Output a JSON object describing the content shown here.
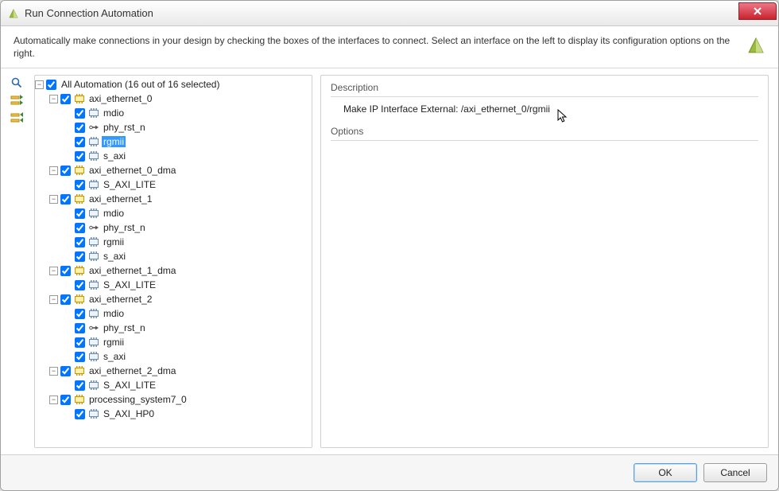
{
  "title": "Run Connection Automation",
  "intro": "Automatically make connections in your design by checking the boxes of the interfaces to connect. Select an interface on the left to display its configuration options on the right.",
  "section": {
    "description_label": "Description",
    "options_label": "Options"
  },
  "description_value": "Make IP Interface External: /axi_ethernet_0/rgmii",
  "buttons": {
    "ok": "OK",
    "cancel": "Cancel"
  },
  "tree": {
    "root": {
      "label": "All Automation (16 out of 16 selected)",
      "checked": true,
      "expanded": true
    },
    "nodes": [
      {
        "label": "axi_ethernet_0",
        "type": "ip",
        "checked": true,
        "expanded": true,
        "children": [
          {
            "label": "mdio",
            "type": "intf",
            "checked": true
          },
          {
            "label": "phy_rst_n",
            "type": "port",
            "checked": true
          },
          {
            "label": "rgmii",
            "type": "intf",
            "checked": true,
            "selected": true
          },
          {
            "label": "s_axi",
            "type": "intf",
            "checked": true
          }
        ]
      },
      {
        "label": "axi_ethernet_0_dma",
        "type": "ip",
        "checked": true,
        "expanded": true,
        "children": [
          {
            "label": "S_AXI_LITE",
            "type": "intf",
            "checked": true
          }
        ]
      },
      {
        "label": "axi_ethernet_1",
        "type": "ip",
        "checked": true,
        "expanded": true,
        "children": [
          {
            "label": "mdio",
            "type": "intf",
            "checked": true
          },
          {
            "label": "phy_rst_n",
            "type": "port",
            "checked": true
          },
          {
            "label": "rgmii",
            "type": "intf",
            "checked": true
          },
          {
            "label": "s_axi",
            "type": "intf",
            "checked": true
          }
        ]
      },
      {
        "label": "axi_ethernet_1_dma",
        "type": "ip",
        "checked": true,
        "expanded": true,
        "children": [
          {
            "label": "S_AXI_LITE",
            "type": "intf",
            "checked": true
          }
        ]
      },
      {
        "label": "axi_ethernet_2",
        "type": "ip",
        "checked": true,
        "expanded": true,
        "children": [
          {
            "label": "mdio",
            "type": "intf",
            "checked": true
          },
          {
            "label": "phy_rst_n",
            "type": "port",
            "checked": true
          },
          {
            "label": "rgmii",
            "type": "intf",
            "checked": true
          },
          {
            "label": "s_axi",
            "type": "intf",
            "checked": true
          }
        ]
      },
      {
        "label": "axi_ethernet_2_dma",
        "type": "ip",
        "checked": true,
        "expanded": true,
        "children": [
          {
            "label": "S_AXI_LITE",
            "type": "intf",
            "checked": true
          }
        ]
      },
      {
        "label": "processing_system7_0",
        "type": "ip",
        "checked": true,
        "expanded": true,
        "children": [
          {
            "label": "S_AXI_HP0",
            "type": "intf",
            "checked": true
          }
        ]
      }
    ]
  }
}
